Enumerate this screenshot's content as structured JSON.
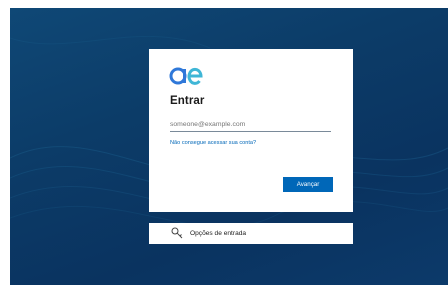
{
  "signin": {
    "logo": "ae-logo",
    "title": "Entrar",
    "email_value": "",
    "email_placeholder": "someone@example.com",
    "cant_access_link": "Não consegue acessar sua conta?",
    "next_label": "Avançar"
  },
  "signin_options": {
    "icon": "key-icon",
    "label": "Opções de entrada"
  },
  "colors": {
    "accent": "#0067b8",
    "background": "#0c3c68",
    "logo_blue": "#2f78d9"
  }
}
